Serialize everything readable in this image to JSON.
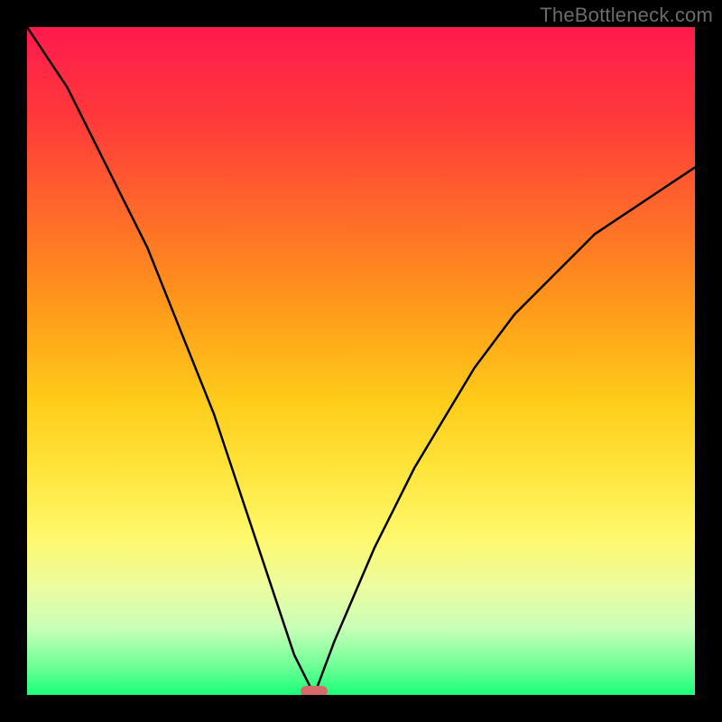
{
  "watermark": "TheBottleneck.com",
  "chart_data": {
    "type": "line",
    "title": "",
    "xlabel": "",
    "ylabel": "",
    "xlim": [
      0,
      1
    ],
    "ylim": [
      0,
      1
    ],
    "curve_minimum_x": 0.43,
    "left_branch": {
      "x": [
        0.0,
        0.02,
        0.04,
        0.06,
        0.08,
        0.1,
        0.12,
        0.14,
        0.16,
        0.18,
        0.2,
        0.22,
        0.24,
        0.26,
        0.28,
        0.3,
        0.32,
        0.34,
        0.36,
        0.38,
        0.4,
        0.43
      ],
      "y": [
        1.0,
        0.97,
        0.94,
        0.91,
        0.87,
        0.83,
        0.79,
        0.75,
        0.71,
        0.67,
        0.62,
        0.57,
        0.52,
        0.47,
        0.42,
        0.36,
        0.3,
        0.24,
        0.18,
        0.12,
        0.06,
        0.0
      ]
    },
    "right_branch": {
      "x": [
        0.43,
        0.46,
        0.49,
        0.52,
        0.55,
        0.58,
        0.61,
        0.64,
        0.67,
        0.7,
        0.73,
        0.76,
        0.79,
        0.82,
        0.85,
        0.88,
        0.91,
        0.94,
        0.97,
        1.0
      ],
      "y": [
        0.0,
        0.08,
        0.15,
        0.22,
        0.28,
        0.34,
        0.39,
        0.44,
        0.49,
        0.53,
        0.57,
        0.6,
        0.63,
        0.66,
        0.69,
        0.71,
        0.73,
        0.75,
        0.77,
        0.79
      ]
    },
    "marker": {
      "x": 0.43,
      "y": 0.005
    },
    "gradient_stops": [
      {
        "pos": 0.0,
        "color": "#ff1a4d"
      },
      {
        "pos": 0.14,
        "color": "#ff3a3a"
      },
      {
        "pos": 0.28,
        "color": "#ff6a2a"
      },
      {
        "pos": 0.42,
        "color": "#ff9a1a"
      },
      {
        "pos": 0.56,
        "color": "#ffcc1a"
      },
      {
        "pos": 0.66,
        "color": "#ffe43a"
      },
      {
        "pos": 0.76,
        "color": "#fff86a"
      },
      {
        "pos": 0.84,
        "color": "#ecfca0"
      },
      {
        "pos": 0.9,
        "color": "#c8ffb8"
      },
      {
        "pos": 0.95,
        "color": "#7aff9a"
      },
      {
        "pos": 1.0,
        "color": "#1aff7a"
      }
    ]
  }
}
